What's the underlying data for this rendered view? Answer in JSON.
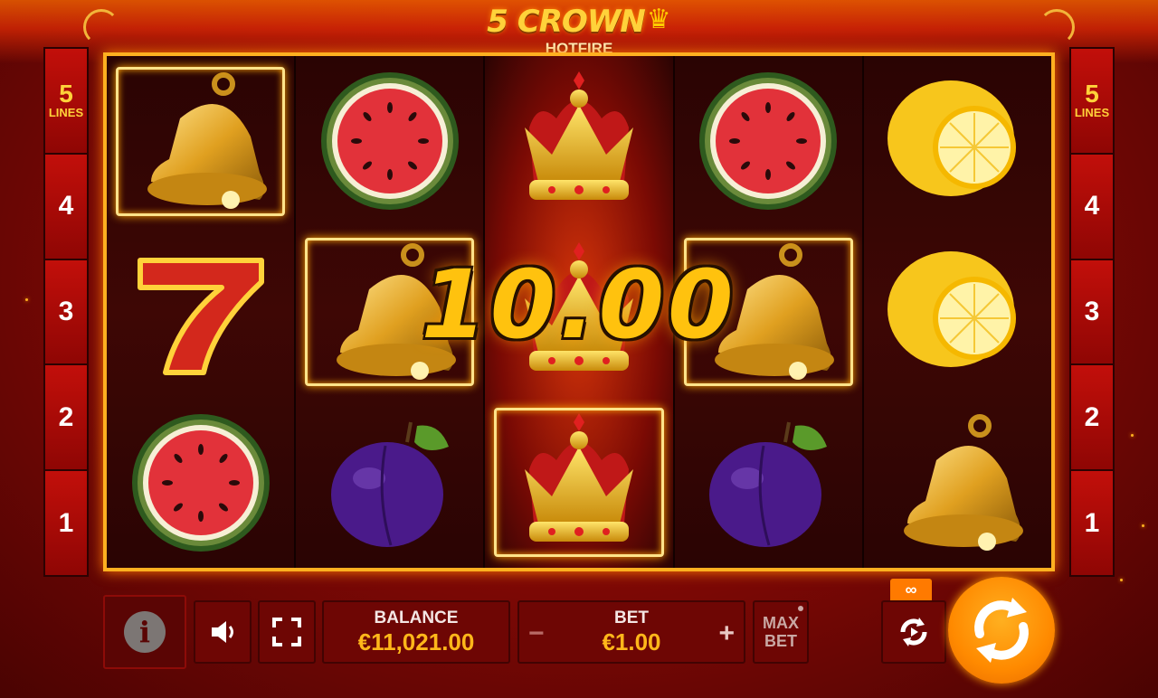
{
  "game": {
    "title": "5 CROWN",
    "subtitle": "HOTFIRE"
  },
  "paylines": {
    "left": [
      {
        "number": "5",
        "label": "LINES"
      },
      {
        "number": "4"
      },
      {
        "number": "3"
      },
      {
        "number": "2"
      },
      {
        "number": "1"
      }
    ],
    "right": [
      {
        "number": "5",
        "label": "LINES"
      },
      {
        "number": "4"
      },
      {
        "number": "3"
      },
      {
        "number": "2"
      },
      {
        "number": "1"
      }
    ]
  },
  "reels": [
    {
      "symbols": [
        "bell",
        "seven",
        "watermelon"
      ],
      "win": [
        true,
        false,
        false
      ]
    },
    {
      "symbols": [
        "watermelon",
        "bell",
        "plum"
      ],
      "win": [
        false,
        true,
        false
      ]
    },
    {
      "symbols": [
        "crown",
        "crown",
        "crown"
      ],
      "win": [
        false,
        false,
        true
      ]
    },
    {
      "symbols": [
        "watermelon",
        "bell",
        "plum"
      ],
      "win": [
        false,
        true,
        false
      ]
    },
    {
      "symbols": [
        "lemon",
        "lemon",
        "bell"
      ],
      "win": [
        false,
        false,
        false
      ]
    }
  ],
  "win": {
    "amount": "10.00"
  },
  "controls": {
    "info_glyph": "i",
    "balance_label": "BALANCE",
    "balance_value": "€11,021.00",
    "bet_label": "BET",
    "bet_value": "€1.00",
    "bet_minus": "−",
    "bet_plus": "+",
    "maxbet_line1": "MAX",
    "maxbet_line2": "BET",
    "autoplay_tag": "∞"
  },
  "colors": {
    "accent": "#ff8a00",
    "gold": "#ffc20e",
    "background": "#8f0604"
  }
}
